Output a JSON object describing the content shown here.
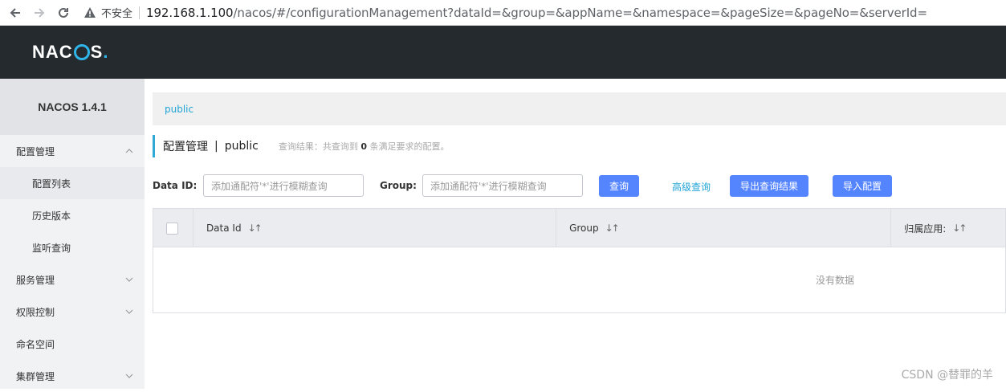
{
  "browser": {
    "insecure_label": "不安全",
    "url_host": "192.168.1.100",
    "url_rest": "/nacos/#/configurationManagement?dataId=&group=&appName=&namespace=&pageSize=&pageNo=&serverId="
  },
  "header": {
    "logo_text_1": "NA",
    "logo_text_2": "C",
    "logo_text_3": "S",
    "logo_dot": "."
  },
  "sidebar": {
    "version": "NACOS 1.4.1",
    "menu": [
      {
        "label": "配置管理"
      },
      {
        "label": "配置列表"
      },
      {
        "label": "历史版本"
      },
      {
        "label": "监听查询"
      },
      {
        "label": "服务管理"
      },
      {
        "label": "权限控制"
      },
      {
        "label": "命名空间"
      },
      {
        "label": "集群管理"
      }
    ]
  },
  "main": {
    "namespace_link": "public",
    "page_title": "配置管理",
    "title_sep": "|",
    "title_ns": "public",
    "result_prefix": "查询结果：共查询到",
    "result_count": "0",
    "result_suffix": "条满足要求的配置。",
    "search": {
      "dataid_label": "Data ID:",
      "dataid_placeholder": "添加通配符'*'进行模糊查询",
      "group_label": "Group:",
      "group_placeholder": "添加通配符'*'进行模糊查询",
      "query_btn": "查询",
      "advanced_link": "高级查询",
      "export_btn": "导出查询结果",
      "import_btn": "导入配置"
    },
    "table": {
      "columns": [
        "Data Id",
        "Group",
        "归属应用:"
      ],
      "sort_glyph": "↓↑",
      "empty_text": "没有数据"
    }
  },
  "watermark": "CSDN @替罪的羊",
  "colors": {
    "primary": "#5584ff",
    "link": "#21a4d6",
    "header_bg": "#252a2f"
  }
}
